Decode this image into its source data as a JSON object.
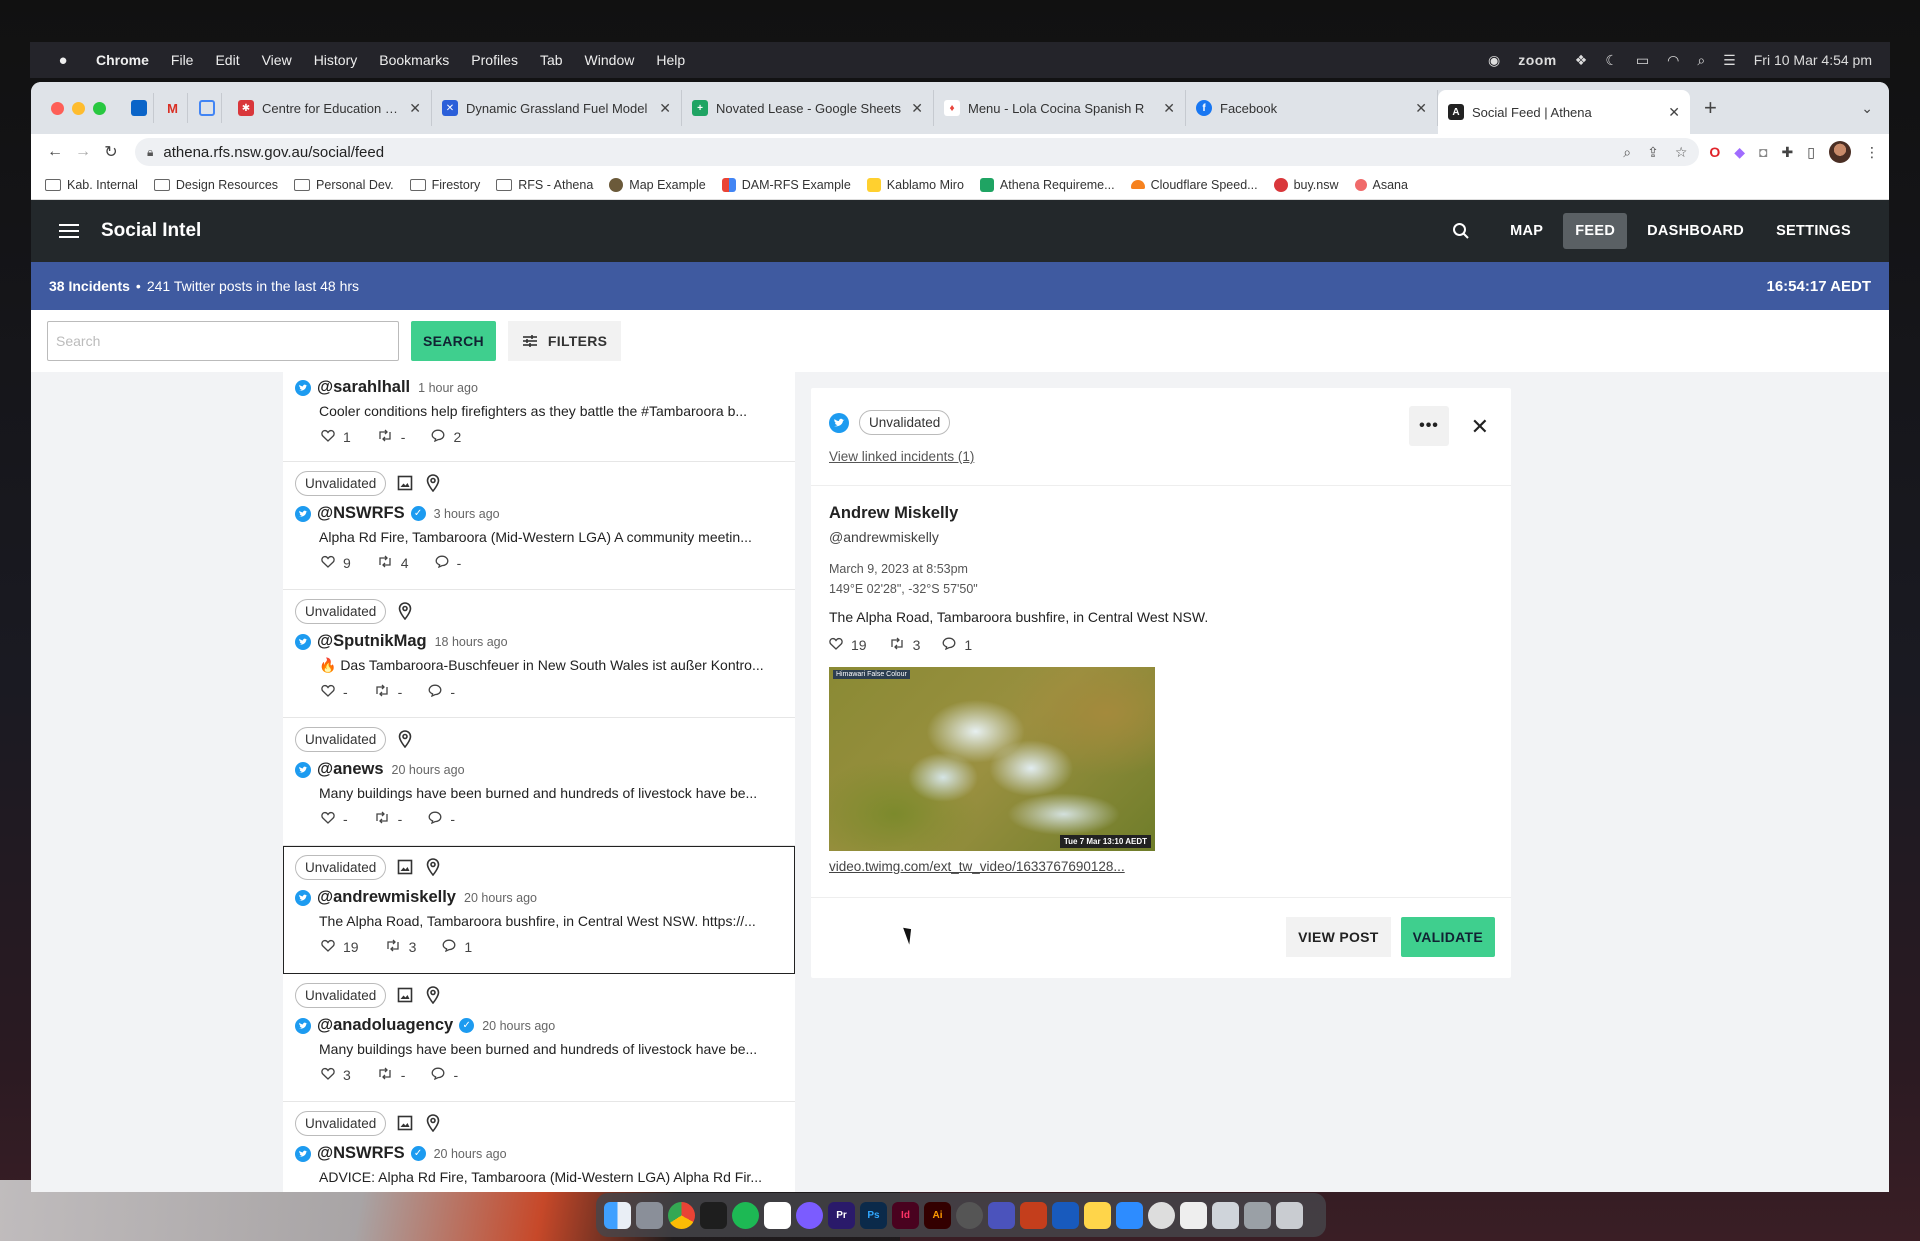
{
  "menubar": {
    "app": "Chrome",
    "items": [
      "File",
      "Edit",
      "View",
      "History",
      "Bookmarks",
      "Profiles",
      "Tab",
      "Window",
      "Help"
    ],
    "zoom_label": "zoom",
    "datetime": "Fri 10 Mar  4:54 pm"
  },
  "browser": {
    "tabs": [
      {
        "title": "Centre for Education Statistics",
        "color": "#d9373b"
      },
      {
        "title": "Dynamic Grassland Fuel Model",
        "color": "#2b5fd9"
      },
      {
        "title": "Novated Lease - Google Sheets",
        "color": "#1fa463"
      },
      {
        "title": "Menu - Lola Cocina Spanish R",
        "color": "#e8453c"
      },
      {
        "title": "Facebook",
        "color": "#1877f2"
      },
      {
        "title": "Social Feed | Athena",
        "color": "#222222"
      }
    ],
    "url": "athena.rfs.nsw.gov.au/social/feed",
    "bookmarks": [
      "Kab. Internal",
      "Design Resources",
      "Personal Dev.",
      "Firestory",
      "RFS - Athena",
      "Map Example",
      "DAM-RFS Example",
      "Kablamo Miro",
      "Athena Requireme...",
      "Cloudflare Speed...",
      "buy.nsw",
      "Asana"
    ]
  },
  "app": {
    "title": "Social Intel",
    "nav": [
      "MAP",
      "FEED",
      "DASHBOARD",
      "SETTINGS"
    ],
    "active_nav": "FEED"
  },
  "status": {
    "incidents": "38 Incidents",
    "separator": "•",
    "posts": "241 Twitter posts in the last 48 hrs",
    "clock": "16:54:17 AEDT"
  },
  "search": {
    "placeholder": "Search",
    "button": "SEARCH",
    "filters": "FILTERS"
  },
  "feed": [
    {
      "handle": "@sarahlhall",
      "verified": false,
      "time": "1 hour ago",
      "text": "Cooler conditions help firefighters as they battle the #Tambaroora b...",
      "likes": "1",
      "retweets": "-",
      "replies": "2",
      "tag": "",
      "image": false,
      "location": false
    },
    {
      "handle": "@NSWRFS",
      "verified": true,
      "time": "3 hours ago",
      "text": "Alpha Rd Fire, Tambaroora (Mid-Western LGA) A community meetin...",
      "likes": "9",
      "retweets": "4",
      "replies": "-",
      "tag": "Unvalidated",
      "image": true,
      "location": true
    },
    {
      "handle": "@SputnikMag",
      "verified": false,
      "time": "18 hours ago",
      "text": "🔥 Das Tambaroora-Buschfeuer in New South Wales ist außer Kontro...",
      "likes": "-",
      "retweets": "-",
      "replies": "-",
      "tag": "Unvalidated",
      "image": false,
      "location": true
    },
    {
      "handle": "@anews",
      "verified": false,
      "time": "20 hours ago",
      "text": "Many buildings have been burned and hundreds of livestock have be...",
      "likes": "-",
      "retweets": "-",
      "replies": "-",
      "tag": "Unvalidated",
      "image": false,
      "location": true
    },
    {
      "handle": "@andrewmiskelly",
      "verified": false,
      "time": "20 hours ago",
      "text": "The Alpha Road, Tambaroora bushfire, in Central West NSW. https://...",
      "likes": "19",
      "retweets": "3",
      "replies": "1",
      "tag": "Unvalidated",
      "image": true,
      "location": true
    },
    {
      "handle": "@anadoluagency",
      "verified": true,
      "time": "20 hours ago",
      "text": "Many buildings have been burned and hundreds of livestock have be...",
      "likes": "3",
      "retweets": "-",
      "replies": "-",
      "tag": "Unvalidated",
      "image": true,
      "location": true
    },
    {
      "handle": "@NSWRFS",
      "verified": true,
      "time": "20 hours ago",
      "text": "ADVICE: Alpha Rd Fire, Tambaroora (Mid-Western LGA) Alpha Rd Fir...",
      "likes": "",
      "retweets": "",
      "replies": "",
      "tag": "Unvalidated",
      "image": true,
      "location": true
    }
  ],
  "detail": {
    "status": "Unvalidated",
    "linked": "View linked incidents (1)",
    "author": "Andrew Miskelly",
    "handle": "@andrewmiskelly",
    "date": "March 9, 2023 at 8:53pm",
    "coords": "149°E 02'28\", -32°S 57'50\"",
    "text": "The Alpha Road, Tambaroora bushfire, in Central West NSW.",
    "likes": "19",
    "retweets": "3",
    "replies": "1",
    "media_label_tl": "Himawari False Colour",
    "media_label_br": "Tue 7 Mar 13:10 AEDT",
    "media_link": "video.twimg.com/ext_tw_video/1633767690128...",
    "view_post": "VIEW POST",
    "validate": "VALIDATE"
  },
  "colors": {
    "appbar": "#23282b",
    "statusbar": "#3f5aa0",
    "accent_green": "#3fcf8e",
    "twitter_blue": "#1d9bf0"
  }
}
